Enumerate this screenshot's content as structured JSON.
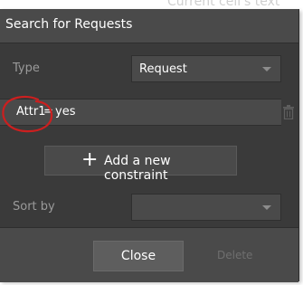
{
  "background": {
    "partial_text": "Current cell's text"
  },
  "dialog": {
    "title": "Search for Requests",
    "type_label": "Type",
    "type_value": "Request",
    "constraint": {
      "attribute": "Attr1",
      "operator": "=",
      "value": "yes"
    },
    "add_constraint_label": "Add a new constraint",
    "sort_by_label": "Sort by",
    "sort_by_value": "",
    "close_label": "Close",
    "delete_label": "Delete"
  },
  "colors": {
    "dialog_bg": "#3a3a3a",
    "panel_bg": "#4a4a4a",
    "annotation": "#cc1f1f"
  },
  "icons": [
    "caret-down-icon",
    "trash-icon",
    "plus-icon"
  ]
}
